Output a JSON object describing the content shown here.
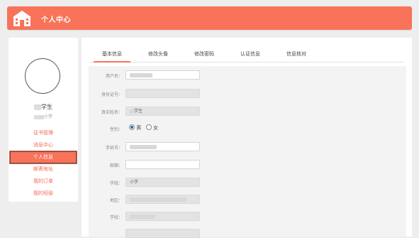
{
  "header": {
    "title": "个人中心"
  },
  "profile": {
    "name_suffix": "学生",
    "school_suffix": "小学"
  },
  "menu": [
    {
      "label": "证书管理"
    },
    {
      "label": "消息中心"
    },
    {
      "label": "个人信息"
    },
    {
      "label": "邮寄地址"
    },
    {
      "label": "我的订单"
    },
    {
      "label": "我的班级"
    }
  ],
  "tabs": [
    {
      "label": "基本信息"
    },
    {
      "label": "修改头像"
    },
    {
      "label": "修改密码"
    },
    {
      "label": "认证信息"
    },
    {
      "label": "信息核对"
    }
  ],
  "form": {
    "username_label": "用户名：",
    "idcard_label": "身份证号：",
    "realname_label": "真实姓名：",
    "realname_suffix": "学生",
    "gender_label": "性别：",
    "gender_male": "男",
    "gender_female": "女",
    "phone_label": "手机号：",
    "email_label": "邮箱：",
    "stage_label": "学段：",
    "stage_value": "小学",
    "region_label": "地区：",
    "school_label": "学校："
  },
  "colors": {
    "accent": "#f8735a",
    "accent_text": "#f36a51",
    "radio_checked": "#2a62c9"
  }
}
